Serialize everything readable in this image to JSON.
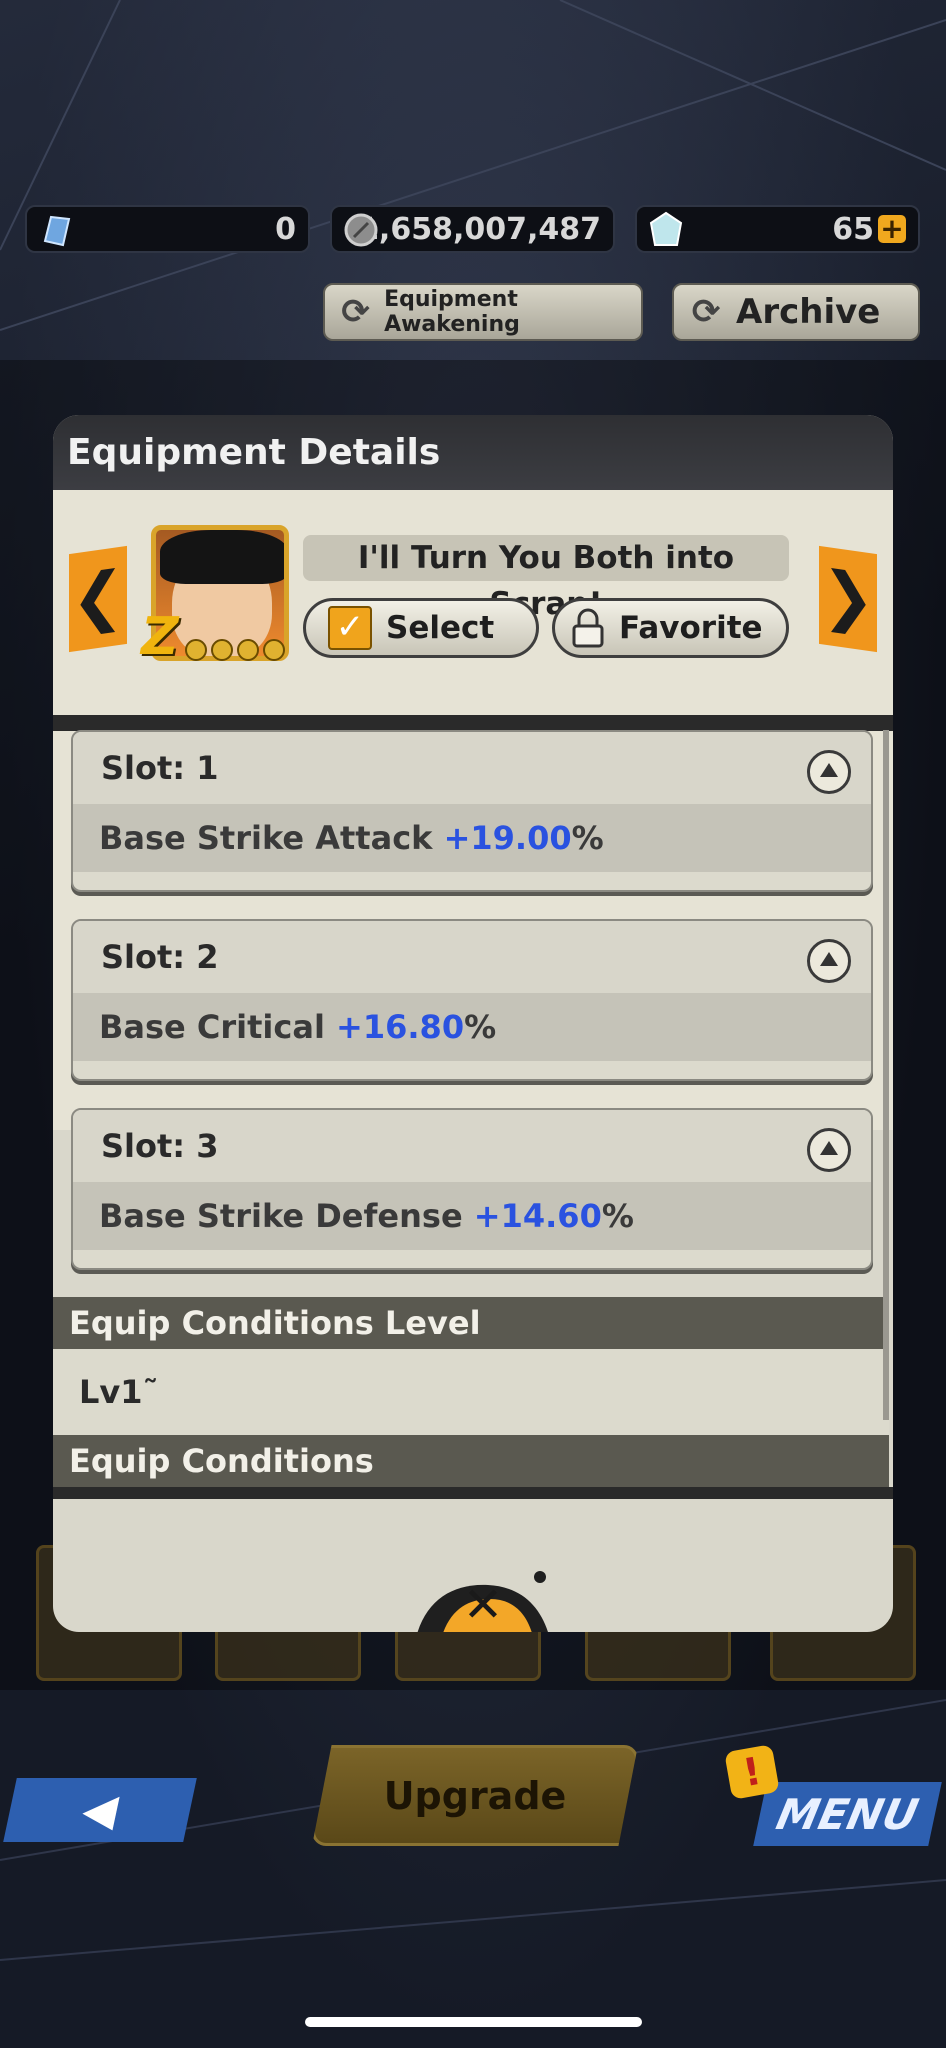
{
  "currency": {
    "stones": "0",
    "zeni": "1,658,007,487",
    "crystals": "65",
    "plus_icon": "+",
    "stone_icon": "blue-stone-icon",
    "zeni_icon": "coin-icon",
    "crystal_icon": "crystal-icon"
  },
  "top_buttons": {
    "awakening_label": "Equipment Awakening",
    "archive_label": "Archive"
  },
  "modal": {
    "title": "Equipment Details",
    "equipment_name": "I'll Turn You Both into Scrap!",
    "rank": "Z",
    "select_label": "Select",
    "favorite_label": "Favorite",
    "prev_arrow": "❮",
    "next_arrow": "❯",
    "slots": [
      {
        "label": "Slot: 1",
        "stat": "Base Strike Attack ",
        "value": "+19.00",
        "unit": "%"
      },
      {
        "label": "Slot: 2",
        "stat": "Base Critical ",
        "value": "+16.80",
        "unit": "%"
      },
      {
        "label": "Slot: 3",
        "stat": "Base Strike Defense ",
        "value": "+14.60",
        "unit": "%"
      }
    ],
    "equip_level_heading": "Equip Conditions Level",
    "equip_level_value": "Lv1˜",
    "equip_conditions_heading": "Equip Conditions",
    "close_icon": "✕"
  },
  "bottom": {
    "upgrade_label": "Upgrade",
    "menu_label": "MENU",
    "back_icon": "◀",
    "menu_badge": "!"
  },
  "colors": {
    "stat_value": "#2a52e0",
    "accent_orange": "#f0961c",
    "nav_blue": "#2d5fb0"
  }
}
